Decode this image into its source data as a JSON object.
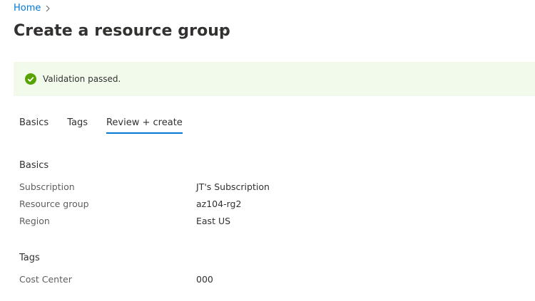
{
  "breadcrumb": {
    "home": "Home"
  },
  "page": {
    "title": "Create a resource group",
    "more": "···"
  },
  "banner": {
    "message": "Validation passed.",
    "color": "#107c10"
  },
  "tabs": [
    {
      "label": "Basics",
      "active": false
    },
    {
      "label": "Tags",
      "active": false
    },
    {
      "label": "Review + create",
      "active": true
    }
  ],
  "basics": {
    "title": "Basics",
    "rows": [
      {
        "key": "Subscription",
        "value": "JT's Subscription"
      },
      {
        "key": "Resource group",
        "value": "az104-rg2"
      },
      {
        "key": "Region",
        "value": "East US"
      }
    ]
  },
  "tags": {
    "title": "Tags",
    "rows": [
      {
        "key": "Cost Center",
        "value": "000"
      }
    ]
  }
}
